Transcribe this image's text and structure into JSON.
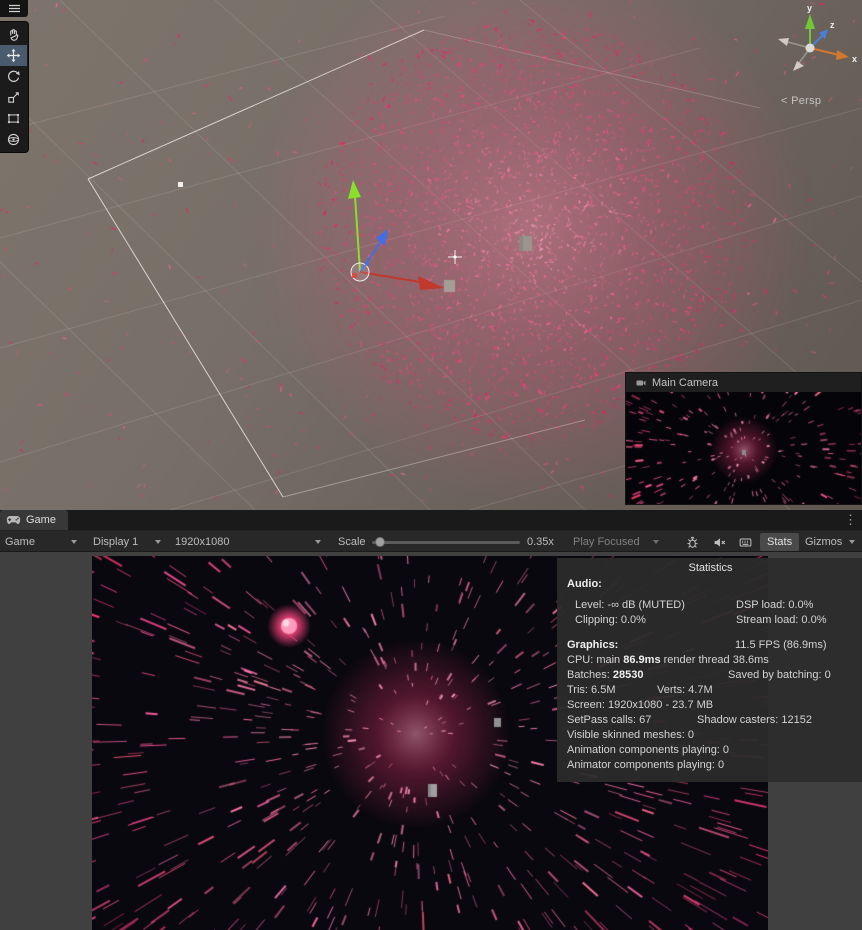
{
  "colors": {
    "particle_pink": "#ff2d6e",
    "tool_selection": "#4a5b6e",
    "axis_x": "#d2782f",
    "axis_y": "#71c837",
    "axis_z": "#4a7ddc"
  },
  "scene": {
    "gizmo": {
      "x": "x",
      "y": "y",
      "z": "z",
      "persp": "< Persp"
    },
    "camera_preview": {
      "title": "Main Camera"
    }
  },
  "game_panel": {
    "tab": "Game",
    "menu_icon": "⋮",
    "toolbar": {
      "view": "Game",
      "display": "Display 1",
      "resolution": "1920x1080",
      "scale_label": "Scale",
      "scale_value": "0.35x",
      "play_focused": "Play Focused",
      "stats": "Stats",
      "gizmos": "Gizmos"
    }
  },
  "statistics": {
    "title": "Statistics",
    "audio_heading": "Audio:",
    "level": "Level: -∞ dB (MUTED)",
    "dsp": "DSP load: 0.0%",
    "clipping": "Clipping: 0.0%",
    "stream": "Stream load: 0.0%",
    "graphics_heading": "Graphics:",
    "fps": "11.5 FPS (86.9ms)",
    "cpu_prefix": "CPU: main",
    "cpu_main": "86.9ms",
    "cpu_rest": "render thread 38.6ms",
    "batches_label": "Batches:",
    "batches_value": "28530",
    "saved_by_batching": "Saved by batching: 0",
    "tris": "Tris: 6.5M",
    "verts": "Verts: 4.7M",
    "screen": "Screen: 1920x1080 - 23.7 MB",
    "setpass": "SetPass calls: 67",
    "shadow_casters": "Shadow casters: 12152",
    "skinned": "Visible skinned meshes: 0",
    "anim_playing": "Animation components playing: 0",
    "animator_playing": "Animator components playing: 0"
  }
}
